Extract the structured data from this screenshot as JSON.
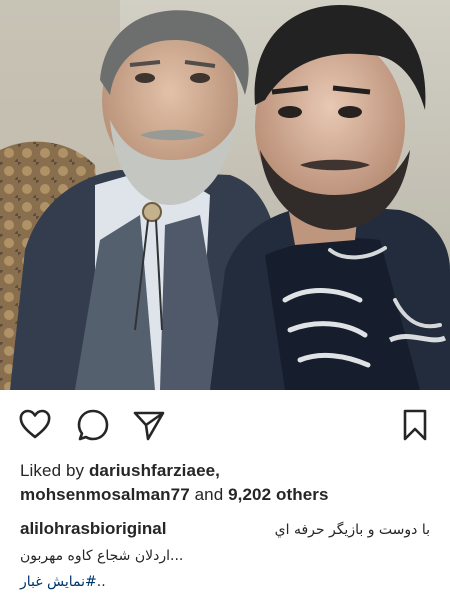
{
  "post": {
    "image_alt": "Selfie of two men, one with grey beard in a vest and bolo tie, one with dark beard and a patterned scarf",
    "colors": {
      "text": "#262626",
      "hashtag": "#003569",
      "background": "#ffffff"
    }
  },
  "actions": {
    "like_icon": "heart-icon",
    "comment_icon": "comment-icon",
    "share_icon": "share-icon",
    "save_icon": "bookmark-icon"
  },
  "likes": {
    "prefix": "Liked by",
    "user1": "dariushfarziaee,",
    "user2": "mohsenmosalman77",
    "conjunction": "and",
    "others": "9,202 others"
  },
  "caption": {
    "username": "alilohrasbioriginal",
    "line1": "با  دوست و بازیگر حرفه اي",
    "line2": "...اردلان شجاع کاوه مهربون",
    "hashtag": "#نمایش غبار",
    "hashtag_tail": ".."
  }
}
